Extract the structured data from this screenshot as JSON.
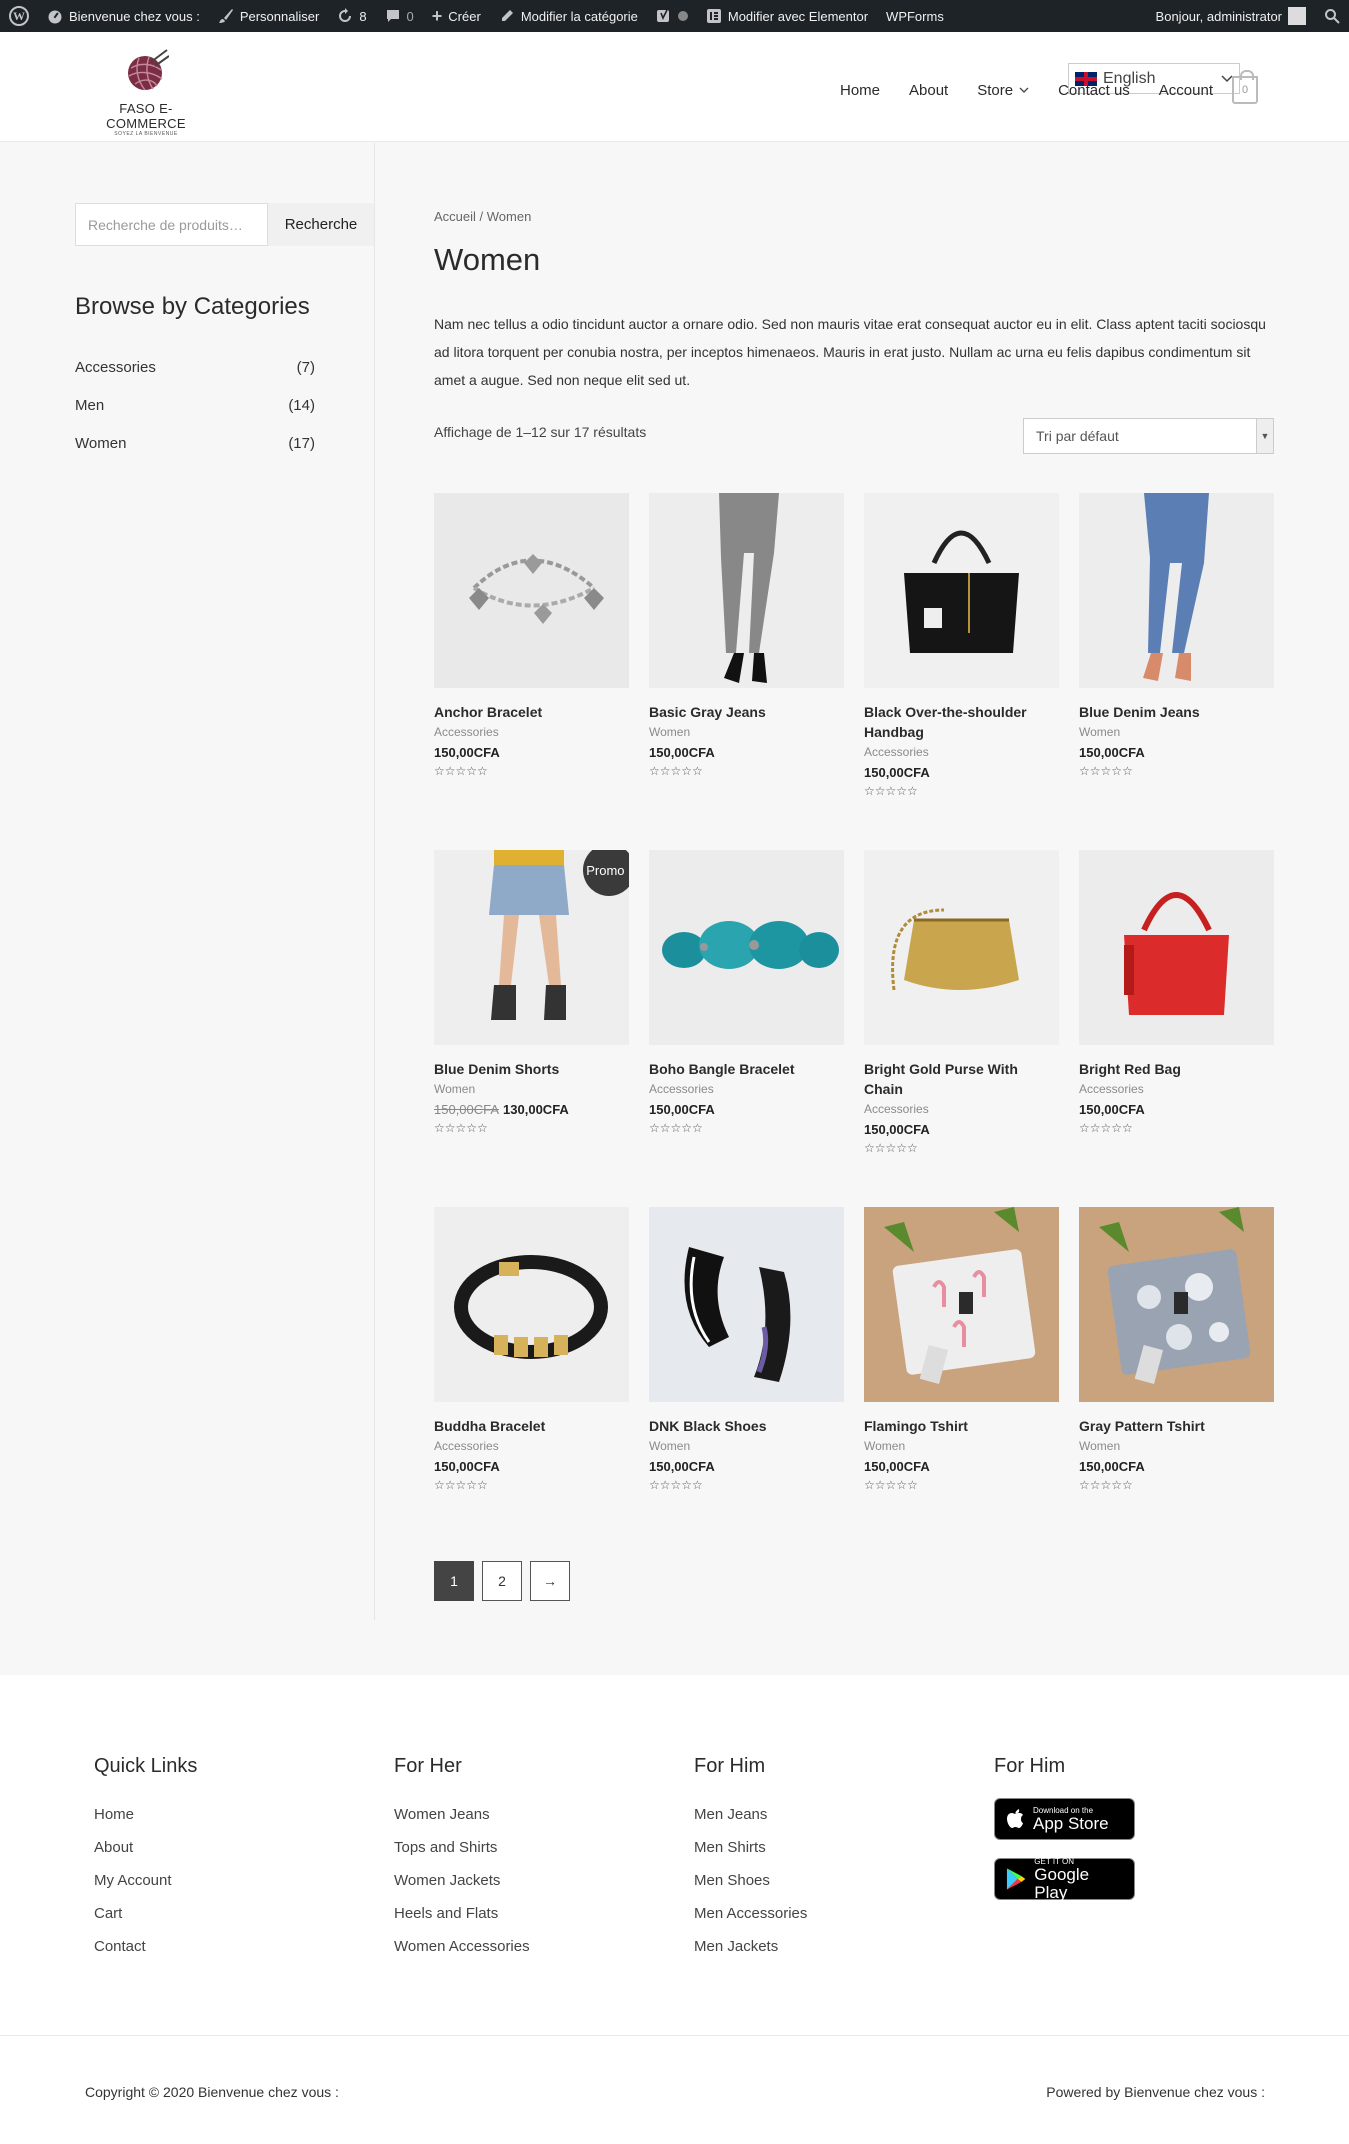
{
  "adminbar": {
    "site": "Bienvenue chez vous :",
    "customize": "Personnaliser",
    "updates": "8",
    "comments": "0",
    "new": "Créer",
    "edit_category": "Modifier la catégorie",
    "elementor": "Modifier avec Elementor",
    "wpforms": "WPForms",
    "greeting": "Bonjour, administrator"
  },
  "header": {
    "logo_text": "FASO E-COMMERCE",
    "logo_sub": "SOYEZ LA BIENVENUE",
    "language": "English",
    "nav": [
      "Home",
      "About",
      "Store",
      "Contact us",
      "Account"
    ],
    "cart_count": "0"
  },
  "sidebar": {
    "search_placeholder": "Recherche de produits…",
    "search_button": "Recherche",
    "categories_title": "Browse by Categories",
    "categories": [
      {
        "name": "Accessories",
        "count": "(7)"
      },
      {
        "name": "Men",
        "count": "(14)"
      },
      {
        "name": "Women",
        "count": "(17)"
      }
    ]
  },
  "main": {
    "breadcrumb": "Accueil / Women",
    "title": "Women",
    "description": "Nam nec tellus a odio tincidunt auctor a ornare odio. Sed non mauris vitae erat consequat auctor eu in elit. Class aptent taciti sociosqu ad litora torquent per conubia nostra, per inceptos himenaeos. Mauris in erat justo. Nullam ac urna eu felis dapibus condimentum sit amet a augue. Sed non neque elit sed ut.",
    "result_count": "Affichage de 1–12 sur 17 résultats",
    "sort": "Tri par défaut",
    "stars": "☆☆☆☆☆",
    "products": [
      {
        "name": "Anchor Bracelet",
        "cat": "Accessories",
        "price": "150,00CFA",
        "img": "bracelet",
        "bg": "#e9e9e9"
      },
      {
        "name": "Basic Gray Jeans",
        "cat": "Women",
        "price": "150,00CFA",
        "img": "gray-jeans",
        "bg": "#ededed"
      },
      {
        "name": "Black Over-the-shoulder Handbag",
        "cat": "Accessories",
        "price": "150,00CFA",
        "img": "handbag",
        "bg": "#f0f0f0"
      },
      {
        "name": "Blue Denim Jeans",
        "cat": "Women",
        "price": "150,00CFA",
        "img": "blue-jeans",
        "bg": "#ededed"
      },
      {
        "name": "Blue Denim Shorts",
        "cat": "Women",
        "old_price": "150,00CFA",
        "price": "130,00CFA",
        "img": "shorts",
        "bg": "#eeeeee",
        "badge": "Promo !"
      },
      {
        "name": "Boho Bangle Bracelet",
        "cat": "Accessories",
        "price": "150,00CFA",
        "img": "bangle",
        "bg": "#ececec"
      },
      {
        "name": "Bright Gold Purse With Chain",
        "cat": "Accessories",
        "price": "150,00CFA",
        "img": "gold-purse",
        "bg": "#f0f0f0"
      },
      {
        "name": "Bright Red Bag",
        "cat": "Accessories",
        "price": "150,00CFA",
        "img": "red-bag",
        "bg": "#ececec"
      },
      {
        "name": "Buddha Bracelet",
        "cat": "Accessories",
        "price": "150,00CFA",
        "img": "buddha",
        "bg": "#eeeeee"
      },
      {
        "name": "DNK Black Shoes",
        "cat": "Women",
        "price": "150,00CFA",
        "img": "shoes",
        "bg": "#e6e9ee"
      },
      {
        "name": "Flamingo Tshirt",
        "cat": "Women",
        "price": "150,00CFA",
        "img": "flamingo",
        "bg": "#c9a27e"
      },
      {
        "name": "Gray Pattern Tshirt",
        "cat": "Women",
        "price": "150,00CFA",
        "img": "pattern",
        "bg": "#c9a27e"
      }
    ],
    "pagination": [
      "1",
      "2",
      "→"
    ]
  },
  "footer": {
    "col1": {
      "title": "Quick Links",
      "links": [
        "Home",
        "About",
        "My Account",
        "Cart",
        "Contact"
      ]
    },
    "col2": {
      "title": "For Her",
      "links": [
        "Women Jeans",
        "Tops and Shirts",
        "Women Jackets",
        "Heels and Flats",
        "Women Accessories"
      ]
    },
    "col3": {
      "title": "For Him",
      "links": [
        "Men Jeans",
        "Men Shirts",
        "Men Shoes",
        "Men Accessories",
        "Men Jackets"
      ]
    },
    "col4": {
      "title": "For Him",
      "appstore_small": "Download on the",
      "appstore_big": "App Store",
      "play_small": "GET IT ON",
      "play_big": "Google Play"
    },
    "copyright": "Copyright © 2020 Bienvenue chez vous :",
    "powered": "Powered by Bienvenue chez vous :"
  }
}
